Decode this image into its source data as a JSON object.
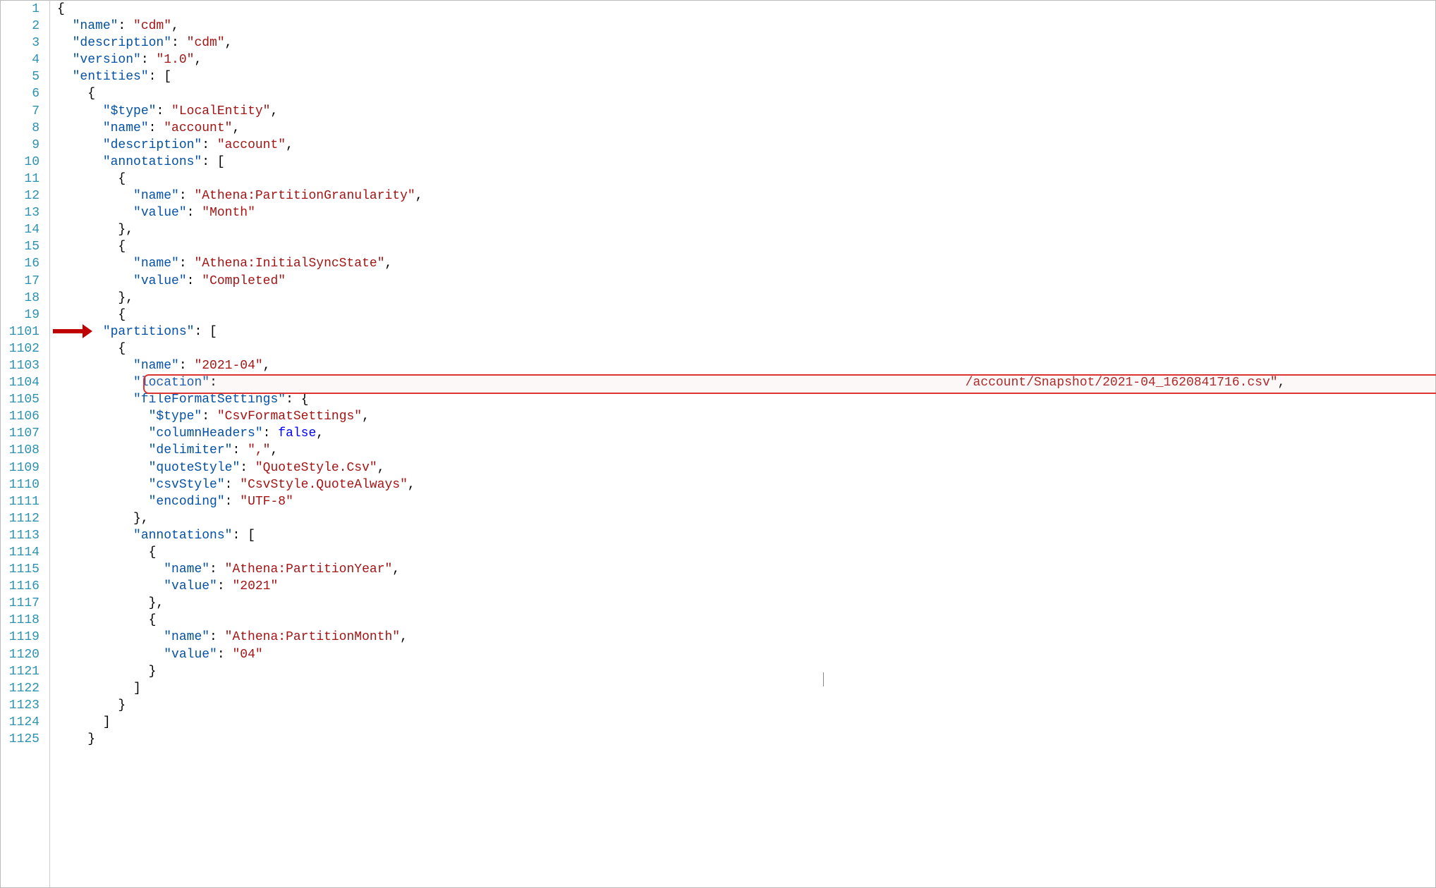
{
  "lineNumbers": [
    "1",
    "2",
    "3",
    "4",
    "5",
    "6",
    "7",
    "8",
    "9",
    "10",
    "11",
    "12",
    "13",
    "14",
    "15",
    "16",
    "17",
    "18",
    "19",
    "1101",
    "1102",
    "1103",
    "1104",
    "1105",
    "1106",
    "1107",
    "1108",
    "1109",
    "1110",
    "1111",
    "1112",
    "1113",
    "1114",
    "1115",
    "1116",
    "1117",
    "1118",
    "1119",
    "1120",
    "1121",
    "1122",
    "1123",
    "1124",
    "1125"
  ],
  "code": {
    "root_open": "{",
    "name_key": "\"name\"",
    "name_val": "\"cdm\"",
    "desc_key": "\"description\"",
    "desc_val": "\"cdm\"",
    "version_key": "\"version\"",
    "version_val": "\"1.0\"",
    "entities_key": "\"entities\"",
    "entities_open": "[",
    "entity_open": "{",
    "type_key": "\"$type\"",
    "type_val": "\"LocalEntity\"",
    "ename_key": "\"name\"",
    "ename_val": "\"account\"",
    "edesc_key": "\"description\"",
    "edesc_val": "\"account\"",
    "anno_key": "\"annotations\"",
    "anno_open": "[",
    "a1_open": "{",
    "a1_name_key": "\"name\"",
    "a1_name_val": "\"Athena:PartitionGranularity\"",
    "a1_value_key": "\"value\"",
    "a1_value_val": "\"Month\"",
    "a1_close": "},",
    "a2_open": "{",
    "a2_name_key": "\"name\"",
    "a2_name_val": "\"Athena:InitialSyncState\"",
    "a2_value_key": "\"value\"",
    "a2_value_val": "\"Completed\"",
    "a2_close": "},",
    "a3_open": "{",
    "partitions_key": "\"partitions\"",
    "partitions_open": "[",
    "p_open": "{",
    "p_name_key": "\"name\"",
    "p_name_val": "\"2021-04\"",
    "p_loc_key": "\"location\"",
    "p_loc_suffix": "/account/Snapshot/2021-04_1620841716.csv\"",
    "ffs_key": "\"fileFormatSettings\"",
    "ffs_open": "{",
    "ffs_type_key": "\"$type\"",
    "ffs_type_val": "\"CsvFormatSettings\"",
    "ffs_ch_key": "\"columnHeaders\"",
    "ffs_ch_val": "false",
    "ffs_delim_key": "\"delimiter\"",
    "ffs_delim_val": "\",\"",
    "ffs_qs_key": "\"quoteStyle\"",
    "ffs_qs_val": "\"QuoteStyle.Csv\"",
    "ffs_cs_key": "\"csvStyle\"",
    "ffs_cs_val": "\"CsvStyle.QuoteAlways\"",
    "ffs_enc_key": "\"encoding\"",
    "ffs_enc_val": "\"UTF-8\"",
    "ffs_close": "},",
    "panno_key": "\"annotations\"",
    "panno_open": "[",
    "pa1_open": "{",
    "pa1_name_key": "\"name\"",
    "pa1_name_val": "\"Athena:PartitionYear\"",
    "pa1_value_key": "\"value\"",
    "pa1_value_val": "\"2021\"",
    "pa1_close": "},",
    "pa2_open": "{",
    "pa2_name_key": "\"name\"",
    "pa2_name_val": "\"Athena:PartitionMonth\"",
    "pa2_value_key": "\"value\"",
    "pa2_value_val": "\"04\"",
    "pa2_close": "}",
    "panno_close": "]",
    "p_close": "}",
    "partitions_close": "]",
    "entity_close": "}"
  },
  "annotations": {
    "arrow_target": "partitions",
    "highlight_target": "location"
  }
}
